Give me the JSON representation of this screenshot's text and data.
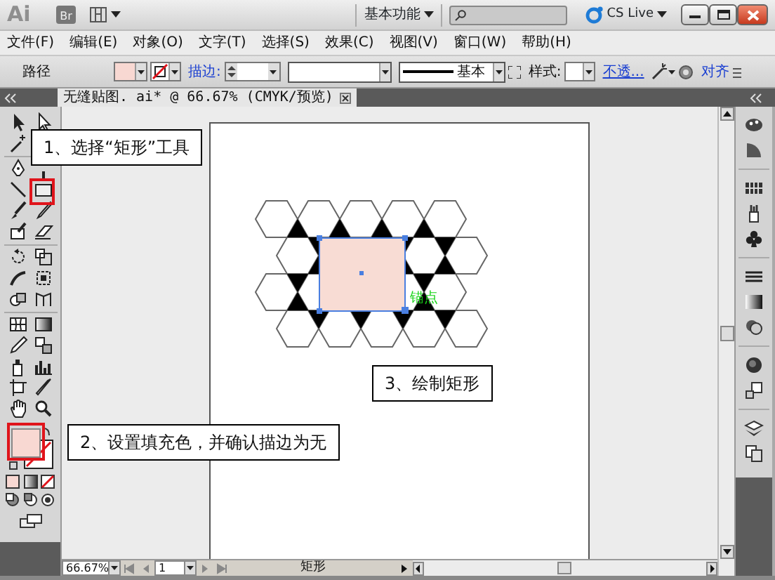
{
  "title_bar": {
    "logo": "Ai",
    "bridge_button": "Br",
    "workspace": "基本功能",
    "cs_live": "CS Live"
  },
  "menu": [
    "文件(F)",
    "编辑(E)",
    "对象(O)",
    "文字(T)",
    "选择(S)",
    "效果(C)",
    "视图(V)",
    "窗口(W)",
    "帮助(H)"
  ],
  "control_bar": {
    "object_type": "路径",
    "stroke_label": "描边:",
    "brush": "基本",
    "style_label": "样式:",
    "opacity_link": "不透...",
    "align_link": "对齐"
  },
  "document_tab": {
    "title": "无缝贴图. ai* @ 66.67% (CMYK/预览)"
  },
  "canvas": {
    "anchor_label": "锚点"
  },
  "callouts": [
    {
      "text": "1、选择“矩形”工具"
    },
    {
      "text": "3、绘制矩形"
    },
    {
      "text": "2、设置填充色，并确认描边为无"
    }
  ],
  "status_bar": {
    "zoom": "66.67%",
    "page": "1",
    "current_tool": "矩形"
  }
}
